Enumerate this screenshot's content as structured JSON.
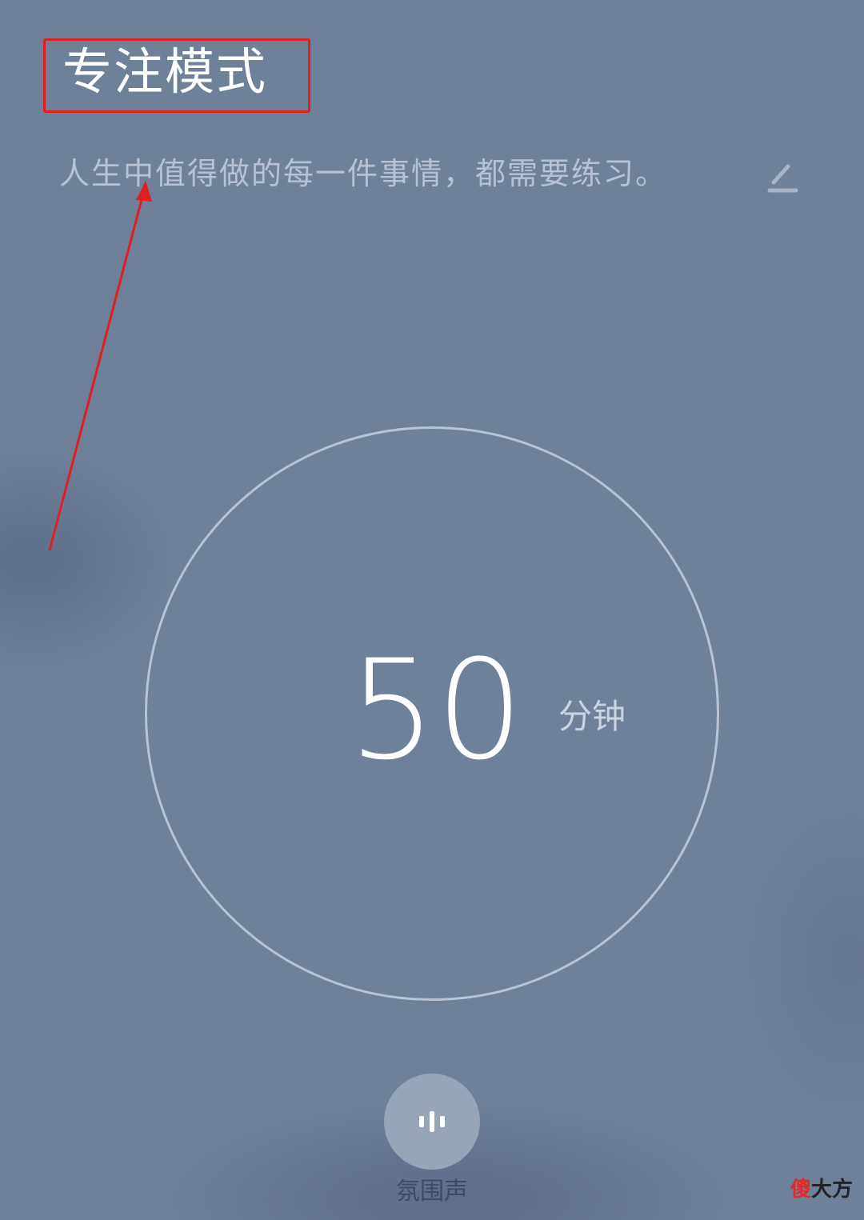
{
  "header": {
    "title": "专注模式",
    "motto": "人生中值得做的每一件事情，都需要练习。",
    "edit_icon": "pencil-icon"
  },
  "timer": {
    "value": "50",
    "unit": "分钟"
  },
  "ambient_sound": {
    "label": "氛围声",
    "icon": "sound-bars-icon"
  },
  "watermark": {
    "part1": "傻",
    "part2": "大方"
  },
  "colors": {
    "background": "#6f8099",
    "annotation_red": "#e02020",
    "ring": "#b9c3d4",
    "button": "#98a4b8"
  }
}
